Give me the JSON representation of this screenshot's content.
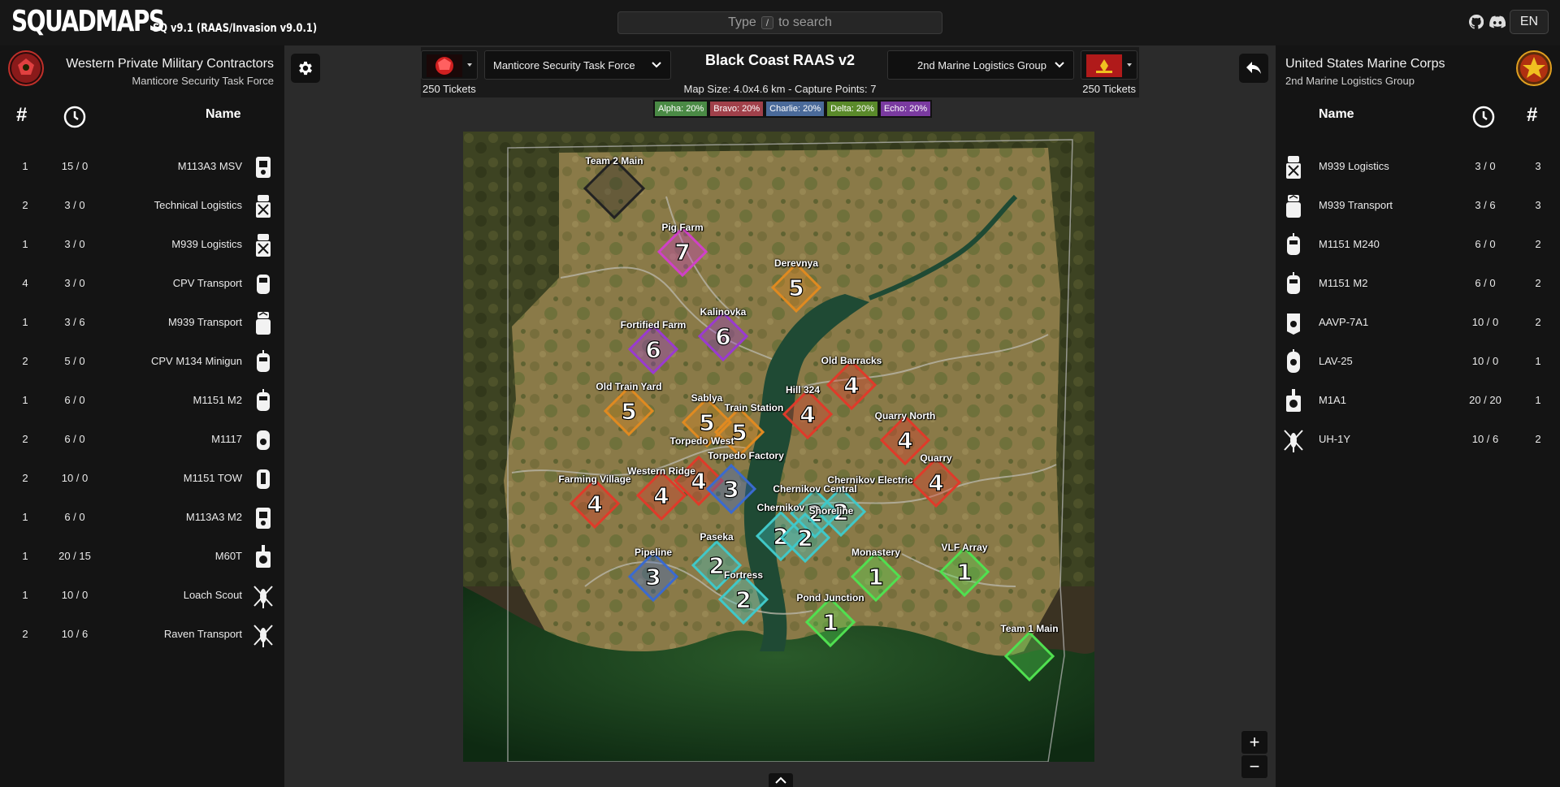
{
  "header": {
    "logo": "SQUADMAPS",
    "version": "SQ v9.1 (RAAS/Invasion v9.0.1)",
    "search_prefix": "Type",
    "search_key": "/",
    "search_suffix": "to search",
    "language": "EN",
    "icons": [
      "github-icon",
      "discord-icon"
    ]
  },
  "left_team": {
    "faction": "Western Private Military Contractors",
    "unit": "Manticore Security Task Force",
    "emblem_text": "Manticore",
    "columns": {
      "count": "#",
      "time_icon": "clock-icon",
      "name": "Name"
    },
    "vehicles": [
      {
        "count": "1",
        "time": "15 / 0",
        "name": "M113A3 MSV",
        "icon": "apc-icon"
      },
      {
        "count": "2",
        "time": "3 / 0",
        "name": "Technical Logistics",
        "icon": "logistics-truck-icon"
      },
      {
        "count": "1",
        "time": "3 / 0",
        "name": "M939 Logistics",
        "icon": "logistics-truck-icon"
      },
      {
        "count": "4",
        "time": "3 / 0",
        "name": "CPV Transport",
        "icon": "transport-car-icon"
      },
      {
        "count": "1",
        "time": "3 / 6",
        "name": "M939 Transport",
        "icon": "transport-truck-icon"
      },
      {
        "count": "2",
        "time": "5 / 0",
        "name": "CPV M134 Minigun",
        "icon": "armed-car-icon"
      },
      {
        "count": "1",
        "time": "6 / 0",
        "name": "M1151 M2",
        "icon": "armed-car-icon"
      },
      {
        "count": "2",
        "time": "6 / 0",
        "name": "M1117",
        "icon": "armored-car-icon"
      },
      {
        "count": "2",
        "time": "10 / 0",
        "name": "M1151 TOW",
        "icon": "atgm-car-icon"
      },
      {
        "count": "1",
        "time": "6 / 0",
        "name": "M113A3 M2",
        "icon": "apc-icon"
      },
      {
        "count": "1",
        "time": "20 / 15",
        "name": "M60T",
        "icon": "tank-icon"
      },
      {
        "count": "1",
        "time": "10 / 0",
        "name": "Loach Scout",
        "icon": "helicopter-icon"
      },
      {
        "count": "2",
        "time": "10 / 6",
        "name": "Raven Transport",
        "icon": "helicopter-icon"
      }
    ],
    "tickets": "250 Tickets",
    "selected_unit": "Manticore Security Task Force"
  },
  "right_team": {
    "faction": "United States Marine Corps",
    "unit": "2nd Marine Logistics Group",
    "columns": {
      "count": "#",
      "time_icon": "clock-icon",
      "name": "Name"
    },
    "vehicles": [
      {
        "count": "3",
        "time": "3 / 0",
        "name": "M939 Logistics",
        "icon": "logistics-truck-icon"
      },
      {
        "count": "3",
        "time": "3 / 6",
        "name": "M939 Transport",
        "icon": "transport-truck-icon"
      },
      {
        "count": "2",
        "time": "6 / 0",
        "name": "M1151 M240",
        "icon": "armed-car-icon"
      },
      {
        "count": "2",
        "time": "6 / 0",
        "name": "M1151 M2",
        "icon": "armed-car-icon"
      },
      {
        "count": "2",
        "time": "10 / 0",
        "name": "AAVP-7A1",
        "icon": "amphibious-apc-icon"
      },
      {
        "count": "1",
        "time": "10 / 0",
        "name": "LAV-25",
        "icon": "ifv-icon"
      },
      {
        "count": "1",
        "time": "20 / 20",
        "name": "M1A1",
        "icon": "tank-icon"
      },
      {
        "count": "2",
        "time": "10 / 6",
        "name": "UH-1Y",
        "icon": "helicopter-icon"
      }
    ],
    "tickets": "250 Tickets",
    "selected_unit": "2nd Marine Logistics Group"
  },
  "match": {
    "map_title": "Black Coast RAAS v2",
    "map_info": "Map Size: 4.0x4.6 km - Capture Points: 7"
  },
  "lanes": [
    {
      "label": "Alpha: 20%",
      "color": "#4a8a45"
    },
    {
      "label": "Bravo: 20%",
      "color": "#a0404a"
    },
    {
      "label": "Charlie: 20%",
      "color": "#4a6a9a"
    },
    {
      "label": "Delta: 20%",
      "color": "#5a8a2a"
    },
    {
      "label": "Echo: 20%",
      "color": "#7a3aa0"
    }
  ],
  "map": {
    "capture_points": [
      {
        "name": "Team 2 Main",
        "num": "",
        "color": "#222222"
      },
      {
        "name": "Pig Farm",
        "num": "7",
        "color": "#d040c8"
      },
      {
        "name": "Derevnya",
        "num": "5",
        "color": "#e08a20"
      },
      {
        "name": "Kalinovka",
        "num": "6",
        "color": "#9a3ad0"
      },
      {
        "name": "Fortified Farm",
        "num": "6",
        "color": "#9a3ad0"
      },
      {
        "name": "Old Barracks",
        "num": "4",
        "color": "#e03a2a"
      },
      {
        "name": "Hill 324",
        "num": "4",
        "color": "#e03a2a"
      },
      {
        "name": "Old Train Yard",
        "num": "5",
        "color": "#e08a20"
      },
      {
        "name": "Sablya",
        "num": "5",
        "color": "#e08a20"
      },
      {
        "name": "Train Station",
        "num": "5",
        "color": "#e08a20"
      },
      {
        "name": "Quarry North",
        "num": "4",
        "color": "#e03a2a"
      },
      {
        "name": "Torpedo West",
        "num": "4",
        "color": "#e03a2a"
      },
      {
        "name": "Torpedo Factory",
        "num": "3",
        "color": "#3a6ad0"
      },
      {
        "name": "Western Ridge",
        "num": "4",
        "color": "#e03a2a"
      },
      {
        "name": "Quarry",
        "num": "4",
        "color": "#e03a2a"
      },
      {
        "name": "Farming Village",
        "num": "4",
        "color": "#e03a2a"
      },
      {
        "name": "Chernikov Electric",
        "num": "2",
        "color": "#40c8c8"
      },
      {
        "name": "Chernikov Central",
        "num": "2",
        "color": "#40c8c8"
      },
      {
        "name": "Chernikov",
        "num": "2",
        "color": "#40c8c8"
      },
      {
        "name": "Shoreline",
        "num": "2",
        "color": "#40c8c8"
      },
      {
        "name": "Pipeline",
        "num": "3",
        "color": "#3a6ad0"
      },
      {
        "name": "Paseka",
        "num": "2",
        "color": "#40c8c8"
      },
      {
        "name": "Fortress",
        "num": "2",
        "color": "#40c8c8"
      },
      {
        "name": "Monastery",
        "num": "1",
        "color": "#50e050"
      },
      {
        "name": "VLF Array",
        "num": "1",
        "color": "#50e050"
      },
      {
        "name": "Pond Junction",
        "num": "1",
        "color": "#50e050"
      },
      {
        "name": "Team 1 Main",
        "num": "",
        "color": "#50e050"
      }
    ]
  },
  "controls": {
    "zoom_in": "+",
    "zoom_out": "−"
  }
}
